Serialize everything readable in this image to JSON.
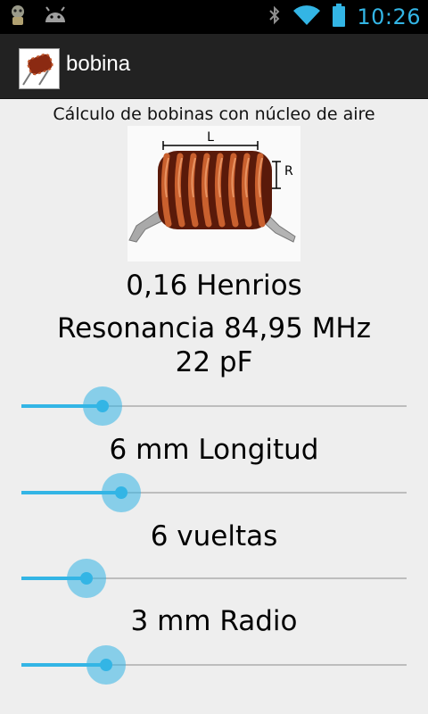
{
  "status_bar": {
    "time": "10:26",
    "icons": [
      "debug-android-icon",
      "android-icon",
      "bluetooth-icon",
      "wifi-icon",
      "battery-icon"
    ],
    "accent_color": "#33b5e5"
  },
  "action_bar": {
    "title": "bobina",
    "icon": "coil-icon"
  },
  "main": {
    "subtitle": "Cálculo de bobinas con núcleo de aire",
    "diagram": {
      "length_label": "L",
      "radius_label": "R"
    },
    "inductance": "0,16 Henrios",
    "resonance": "Resonancia 84,95 MHz",
    "capacitance": "22 pF",
    "length_label": "6 mm  Longitud",
    "turns_label": "6 vueltas",
    "radius_label": "3 mm  Radio"
  },
  "sliders": {
    "capacitance": {
      "fraction": 0.21
    },
    "length": {
      "fraction": 0.26
    },
    "turns": {
      "fraction": 0.17
    },
    "radius": {
      "fraction": 0.22
    }
  }
}
